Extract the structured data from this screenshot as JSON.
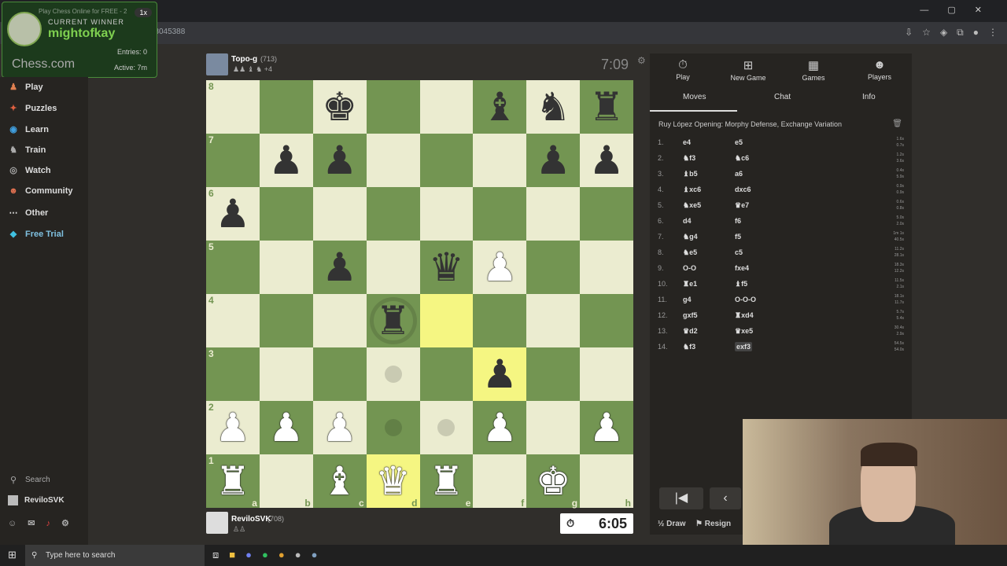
{
  "browser": {
    "tab_title": "Play Chess Online for FREE - 2",
    "url": "/game/167138045388"
  },
  "overlay": {
    "current_label": "CURRENT WINNER",
    "winner": "mightofkay",
    "streak": "1x",
    "logo": "Chess.com",
    "entries": "Entries: 0",
    "active": "Active: 7m"
  },
  "sidebar": {
    "items": [
      {
        "label": "Play",
        "icon": "play-icon"
      },
      {
        "label": "Puzzles",
        "icon": "puzzle-icon"
      },
      {
        "label": "Learn",
        "icon": "learn-icon"
      },
      {
        "label": "Train",
        "icon": "train-icon"
      },
      {
        "label": "Watch",
        "icon": "watch-icon"
      },
      {
        "label": "Community",
        "icon": "community-icon"
      },
      {
        "label": "Other",
        "icon": "more-icon"
      },
      {
        "label": "Free Trial",
        "icon": "diamond-icon"
      }
    ],
    "search": "Search",
    "user": "ReviloSVK"
  },
  "top_player": {
    "name": "Topo-g",
    "rating": "(713)",
    "captured": "♟♟ ♝ ♞ +4",
    "clock": "7:09"
  },
  "bottom_player": {
    "name": "ReviloSVK",
    "rating": "(708)",
    "captured": "♙♙",
    "clock": "6:05"
  },
  "board": {
    "ranks": [
      "8",
      "7",
      "6",
      "5",
      "4",
      "3",
      "2",
      "1"
    ],
    "files": [
      "a",
      "b",
      "c",
      "d",
      "e",
      "f",
      "g",
      "h"
    ],
    "rows": [
      [
        "",
        "",
        "bk",
        "",
        "",
        "bb",
        "bn",
        "br"
      ],
      [
        "",
        "bp",
        "bp",
        "",
        "",
        "",
        "bp",
        "bp"
      ],
      [
        "bp",
        "",
        "",
        "",
        "",
        "",
        "",
        ""
      ],
      [
        "",
        "",
        "bp",
        "",
        "bq",
        "wp",
        "",
        ""
      ],
      [
        "",
        "",
        "",
        "br",
        "",
        "",
        "",
        ""
      ],
      [
        "",
        "",
        "",
        "",
        "",
        "bp",
        "",
        ""
      ],
      [
        "wp",
        "wp",
        "wp",
        "",
        "",
        "wp",
        "",
        "wp"
      ],
      [
        "wr",
        "",
        "wb",
        "wq",
        "wr",
        "",
        "wk",
        ""
      ]
    ],
    "highlight": [
      "e4",
      "f3",
      "d1"
    ]
  },
  "panel": {
    "tabs": [
      {
        "label": "Play",
        "icon": "stopwatch-icon"
      },
      {
        "label": "New Game",
        "icon": "plus-icon"
      },
      {
        "label": "Games",
        "icon": "board-icon"
      },
      {
        "label": "Players",
        "icon": "players-icon"
      }
    ],
    "subtabs": [
      "Moves",
      "Chat",
      "Info"
    ],
    "opening": "Ruy López Opening: Morphy Defense, Exchange Variation",
    "moves": [
      {
        "n": "1.",
        "w": "e4",
        "b": "e5",
        "tw": "1.6s",
        "tb": "0.7s"
      },
      {
        "n": "2.",
        "w": "♞f3",
        "b": "♞c6",
        "tw": "1.2s",
        "tb": "3.6s"
      },
      {
        "n": "3.",
        "w": "♝b5",
        "b": "a6",
        "tw": "0.4s",
        "tb": "5.9s"
      },
      {
        "n": "4.",
        "w": "♝xc6",
        "b": "dxc6",
        "tw": "0.9s",
        "tb": "0.9s"
      },
      {
        "n": "5.",
        "w": "♞xe5",
        "b": "♛e7",
        "tw": "0.6s",
        "tb": "0.8s"
      },
      {
        "n": "6.",
        "w": "d4",
        "b": "f6",
        "tw": "5.0s",
        "tb": "2.0s"
      },
      {
        "n": "7.",
        "w": "♞g4",
        "b": "f5",
        "tw": "1m 1s",
        "tb": "40.5s"
      },
      {
        "n": "8.",
        "w": "♞e5",
        "b": "c5",
        "tw": "11.2s",
        "tb": "28.1s"
      },
      {
        "n": "9.",
        "w": "O-O",
        "b": "fxe4",
        "tw": "18.3s",
        "tb": "12.2s"
      },
      {
        "n": "10.",
        "w": "♜e1",
        "b": "♝f5",
        "tw": "11.5s",
        "tb": "2.1s"
      },
      {
        "n": "11.",
        "w": "g4",
        "b": "O-O-O",
        "tw": "18.1s",
        "tb": "11.7s"
      },
      {
        "n": "12.",
        "w": "gxf5",
        "b": "♜xd4",
        "tw": "5.7s",
        "tb": "5.4s"
      },
      {
        "n": "13.",
        "w": "♛d2",
        "b": "♛xe5",
        "tw": "30.4s",
        "tb": "2.9s"
      },
      {
        "n": "14.",
        "w": "♞f3",
        "b": "exf3",
        "tw": "54.5s",
        "tb": "54.0s"
      }
    ],
    "draw": "Draw",
    "resign": "Resign"
  },
  "taskbar": {
    "search_placeholder": "Type here to search"
  },
  "colors": {
    "light_square": "#ebecd0",
    "dark_square": "#739552",
    "highlight": "#f5f682",
    "accent_green": "#7fd050"
  }
}
